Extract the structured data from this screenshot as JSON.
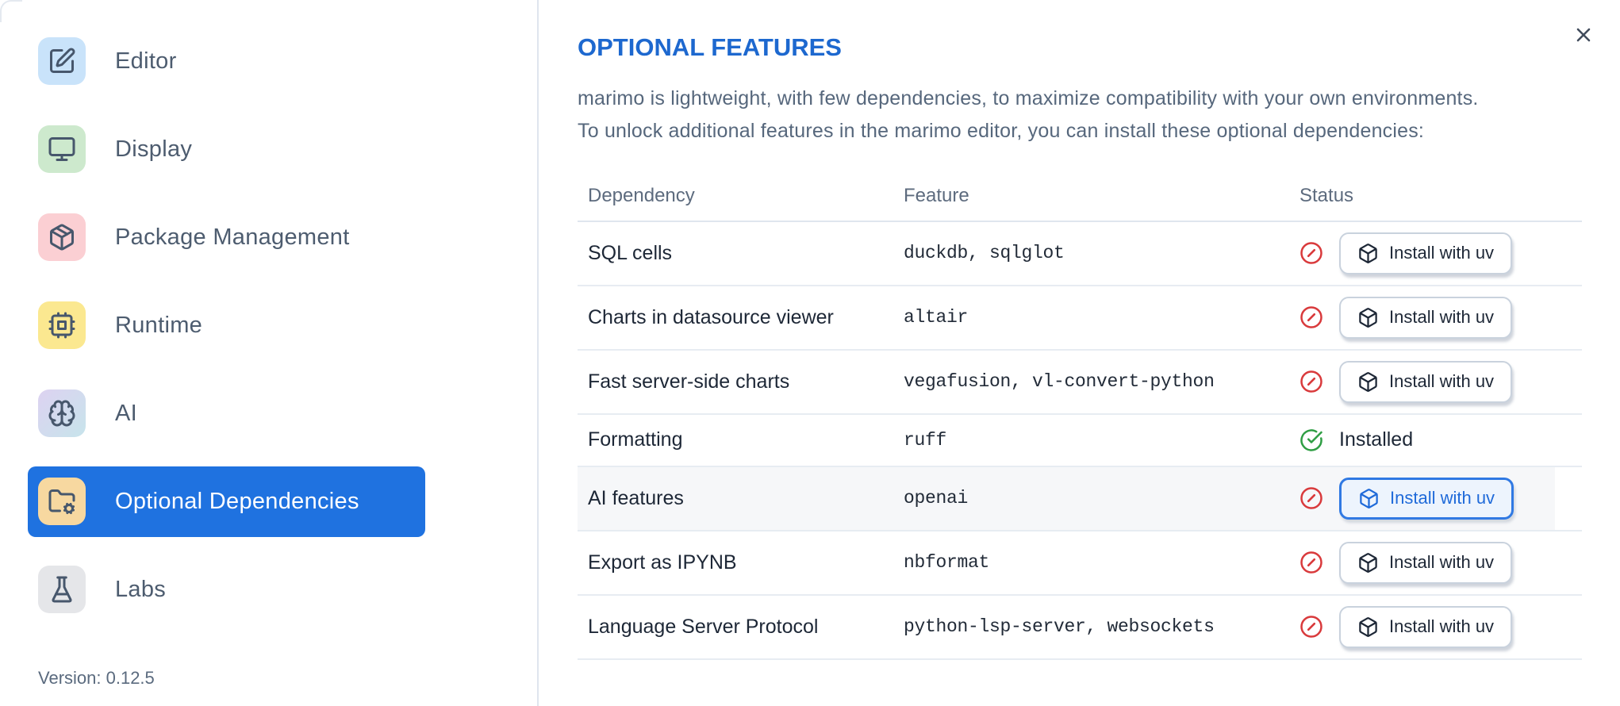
{
  "sidebar": {
    "items": [
      {
        "label": "Editor",
        "icon": "square-pen",
        "tile_bg": "#c9e3fa",
        "selected": false
      },
      {
        "label": "Display",
        "icon": "monitor",
        "tile_bg": "#cde9cd",
        "selected": false
      },
      {
        "label": "Package Management",
        "icon": "package",
        "tile_bg": "#fbcfd3",
        "selected": false
      },
      {
        "label": "Runtime",
        "icon": "cpu",
        "tile_bg": "#fbe890",
        "selected": false
      },
      {
        "label": "AI",
        "icon": "brain",
        "tile_bg": "#ddd2f1",
        "tile_bg2": "#c7e4eb",
        "selected": false
      },
      {
        "label": "Optional Dependencies",
        "icon": "folder-cog",
        "tile_bg": "#f7d8a0",
        "selected": true
      },
      {
        "label": "Labs",
        "icon": "flask",
        "tile_bg": "#e5e6e9",
        "selected": false
      }
    ],
    "version_label": "Version: 0.12.5"
  },
  "panel": {
    "title": "OPTIONAL FEATURES",
    "description_line1": "marimo is lightweight, with few dependencies, to maximize compatibility with your own environments.",
    "description_line2": "To unlock additional features in the marimo editor, you can install these optional dependencies:"
  },
  "table": {
    "headers": [
      "Dependency",
      "Feature",
      "Status"
    ],
    "install_button_label": "Install with uv",
    "installed_label": "Installed",
    "rows": [
      {
        "dependency": "SQL cells",
        "feature": "duckdb, sqlglot",
        "installed": false,
        "focused": false,
        "highlighted": false
      },
      {
        "dependency": "Charts in datasource viewer",
        "feature": "altair",
        "installed": false,
        "focused": false,
        "highlighted": false
      },
      {
        "dependency": "Fast server-side charts",
        "feature": "vegafusion, vl-convert-python",
        "installed": false,
        "focused": false,
        "highlighted": false
      },
      {
        "dependency": "Formatting",
        "feature": "ruff",
        "installed": true,
        "focused": false,
        "highlighted": false
      },
      {
        "dependency": "AI features",
        "feature": "openai",
        "installed": false,
        "focused": true,
        "highlighted": true
      },
      {
        "dependency": "Export as IPYNB",
        "feature": "nbformat",
        "installed": false,
        "focused": false,
        "highlighted": false
      },
      {
        "dependency": "Language Server Protocol",
        "feature": "python-lsp-server, websockets",
        "installed": false,
        "focused": false,
        "highlighted": false
      }
    ]
  },
  "colors": {
    "accent_blue": "#1f72e0",
    "title_blue": "#1d68cf",
    "focus_button_blue": "#1f6ad9",
    "status_error_red": "#d93a3c",
    "status_ok_green": "#2f9e44"
  }
}
